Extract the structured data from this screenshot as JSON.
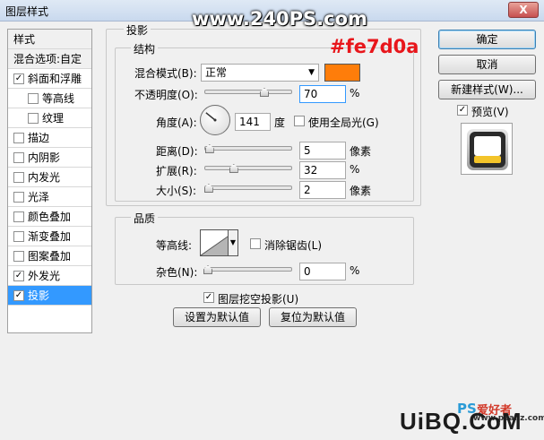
{
  "window": {
    "title": "图层样式",
    "close_label": "X"
  },
  "overlay": {
    "watermark_top": "www.240PS.com",
    "color_hex_label": "#fe7d0a",
    "brand_bottom_a": "PS",
    "brand_bottom_b": "爱好者",
    "brand_bottom_c": "UiBQ.CoM",
    "brand_url": "www.psahz.com"
  },
  "sidebar": {
    "header": "样式",
    "blend_options": "混合选项:自定",
    "items": [
      {
        "label": "斜面和浮雕",
        "checked": true,
        "indent": false
      },
      {
        "label": "等高线",
        "checked": false,
        "indent": true
      },
      {
        "label": "纹理",
        "checked": false,
        "indent": true
      },
      {
        "label": "描边",
        "checked": false,
        "indent": false
      },
      {
        "label": "内阴影",
        "checked": false,
        "indent": false
      },
      {
        "label": "内发光",
        "checked": false,
        "indent": false
      },
      {
        "label": "光泽",
        "checked": false,
        "indent": false
      },
      {
        "label": "颜色叠加",
        "checked": false,
        "indent": false
      },
      {
        "label": "渐变叠加",
        "checked": false,
        "indent": false
      },
      {
        "label": "图案叠加",
        "checked": false,
        "indent": false
      },
      {
        "label": "外发光",
        "checked": true,
        "indent": false
      },
      {
        "label": "投影",
        "checked": true,
        "indent": false,
        "selected": true
      }
    ]
  },
  "panel": {
    "section_title": "投影",
    "structure": {
      "title": "结构",
      "blend_mode_label": "混合模式(B):",
      "blend_mode_value": "正常",
      "swatch_color": "#fe7d0a",
      "opacity_label": "不透明度(O):",
      "opacity_value": "70",
      "opacity_unit": "%",
      "opacity_fraction": 0.7,
      "angle_label": "角度(A):",
      "angle_value": "141",
      "angle_unit": "度",
      "global_light_label": "使用全局光(G)",
      "global_light_checked": false,
      "distance_label": "距离(D):",
      "distance_value": "5",
      "distance_unit": "像素",
      "distance_fraction": 0.02,
      "spread_label": "扩展(R):",
      "spread_value": "32",
      "spread_unit": "%",
      "spread_fraction": 0.32,
      "size_label": "大小(S):",
      "size_value": "2",
      "size_unit": "像素",
      "size_fraction": 0.01
    },
    "quality": {
      "title": "品质",
      "contour_label": "等高线:",
      "antialias_label": "消除锯齿(L)",
      "antialias_checked": false,
      "noise_label": "杂色(N):",
      "noise_value": "0",
      "noise_unit": "%",
      "noise_fraction": 0.0
    },
    "knockout_label": "图层挖空投影(U)",
    "knockout_checked": true,
    "make_default_label": "设置为默认值",
    "reset_default_label": "复位为默认值"
  },
  "actions": {
    "ok_label": "确定",
    "cancel_label": "取消",
    "new_style_label": "新建样式(W)...",
    "preview_label": "预览(V)",
    "preview_checked": true
  }
}
